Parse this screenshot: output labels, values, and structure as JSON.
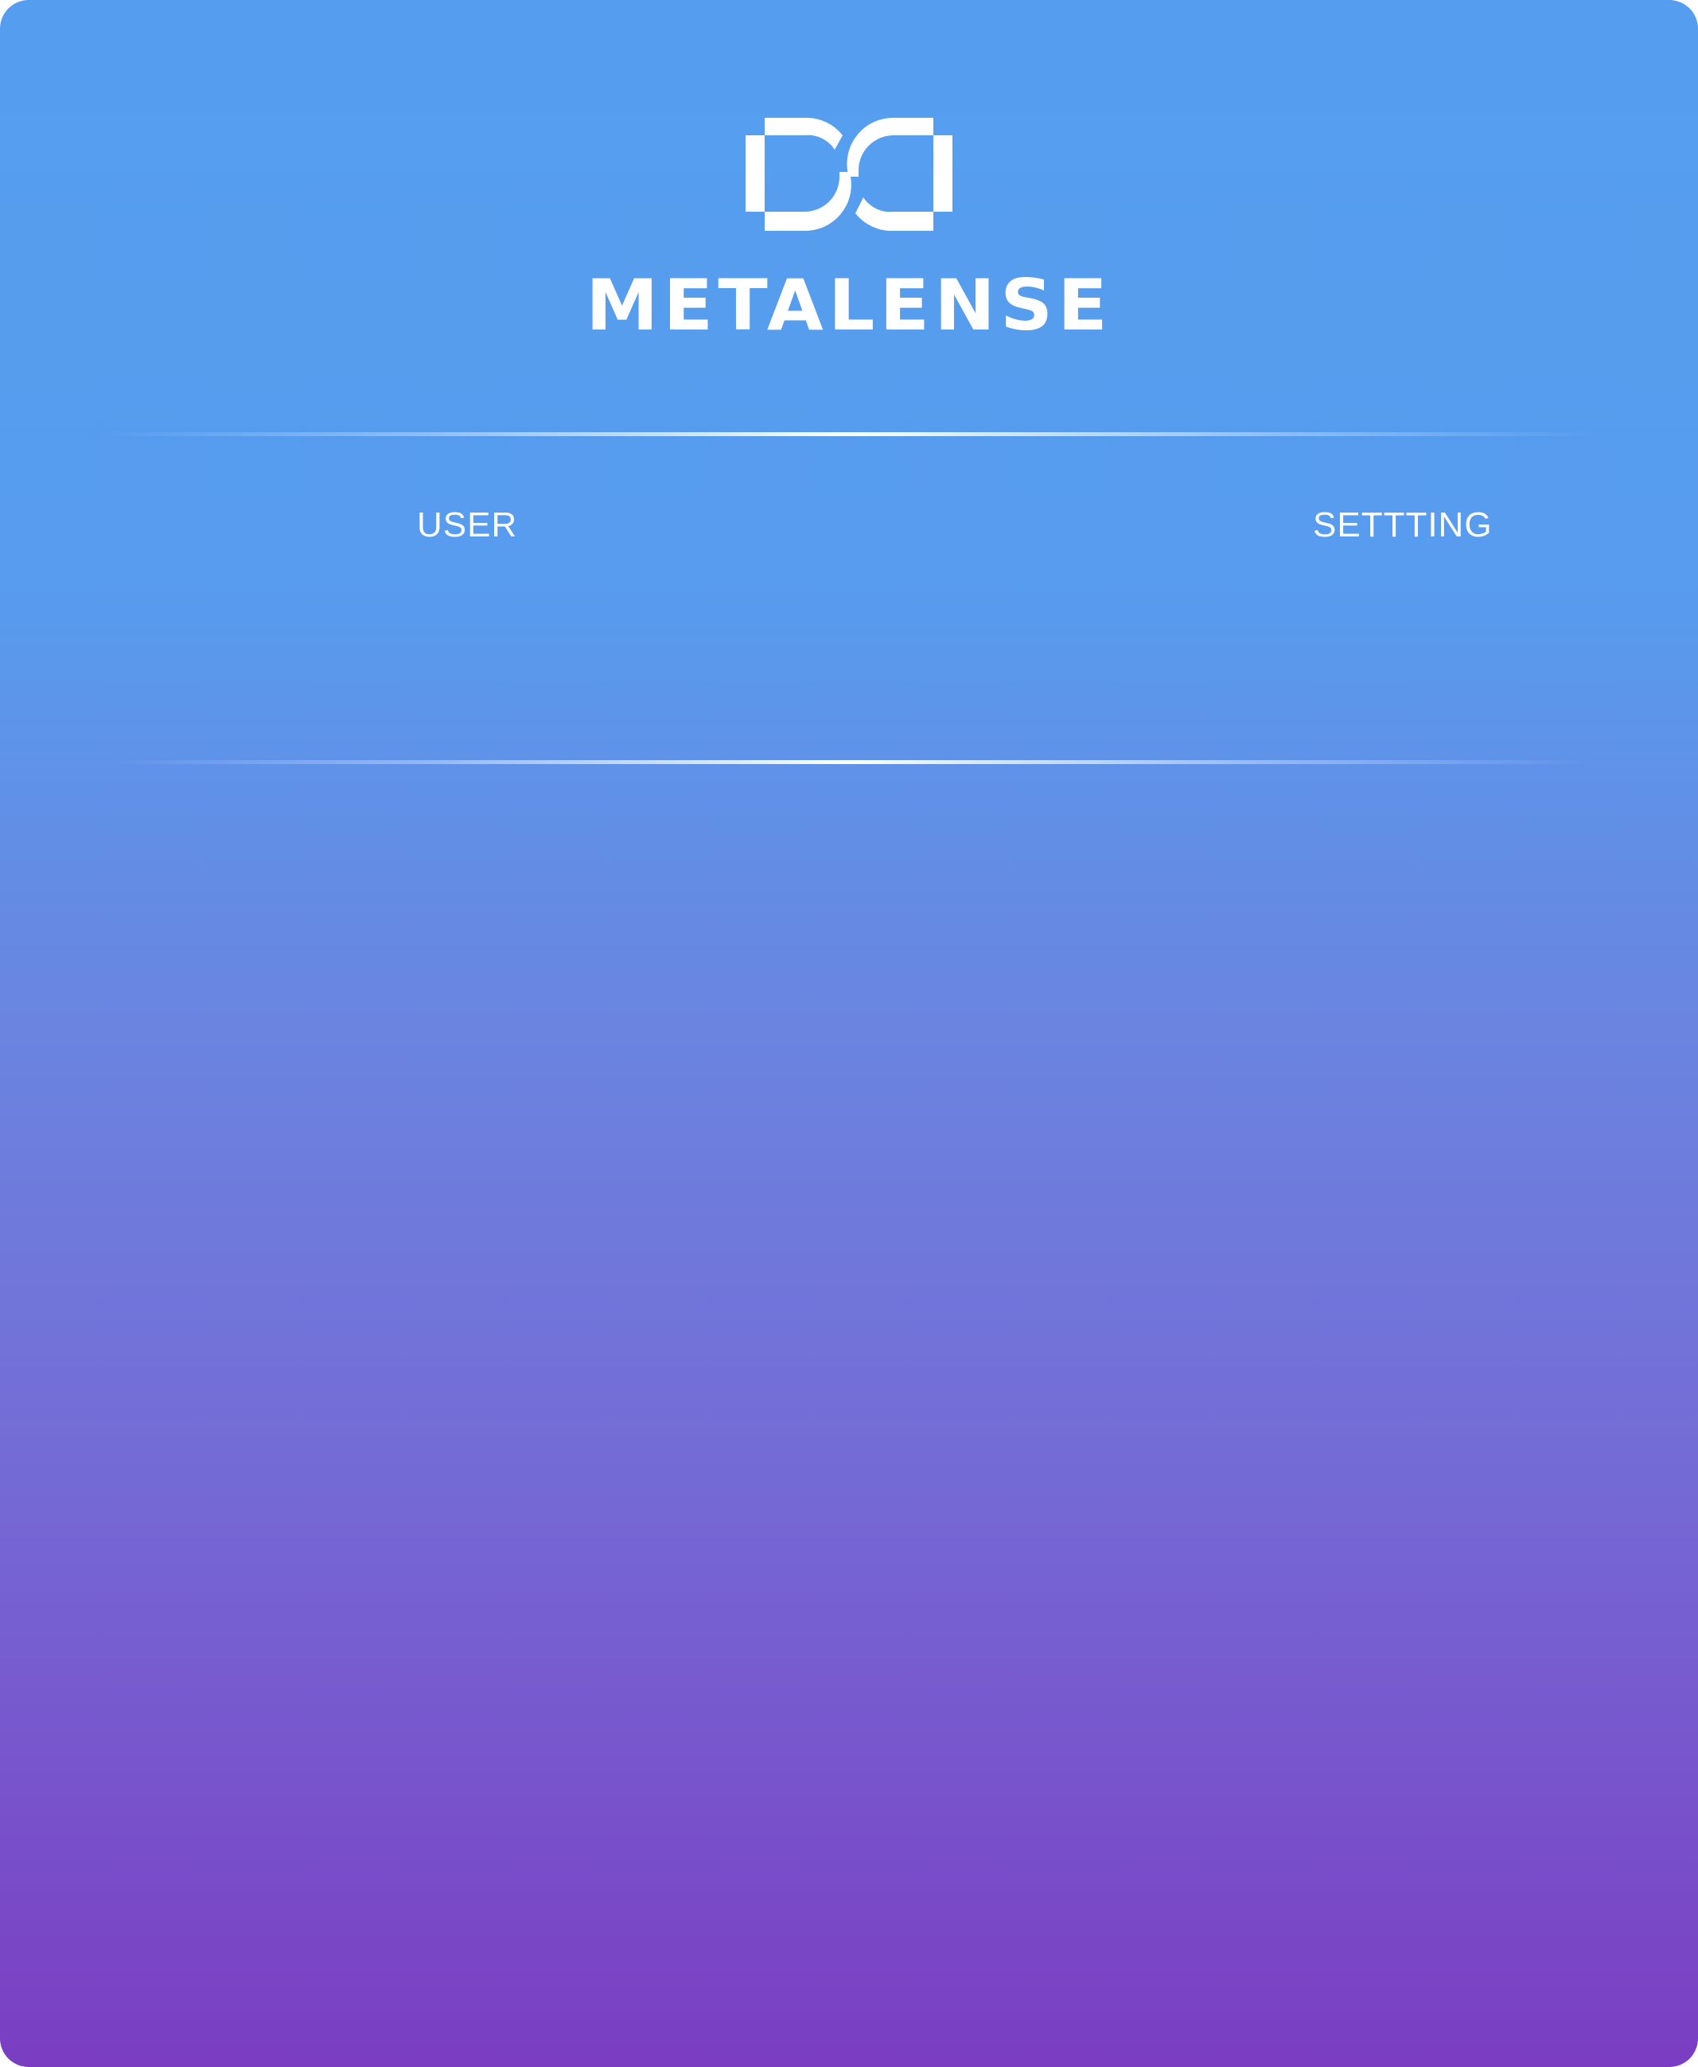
{
  "brand": {
    "name": "METALENSE",
    "logo_icon": "metalense-logo-icon",
    "color": "#ffffff"
  },
  "nav": {
    "user_label": "USER",
    "setting_label": "SETTTING"
  },
  "theme": {
    "gradient_top": "#559eef",
    "gradient_bottom": "#7a3dc2",
    "text_color": "#ffffff"
  }
}
